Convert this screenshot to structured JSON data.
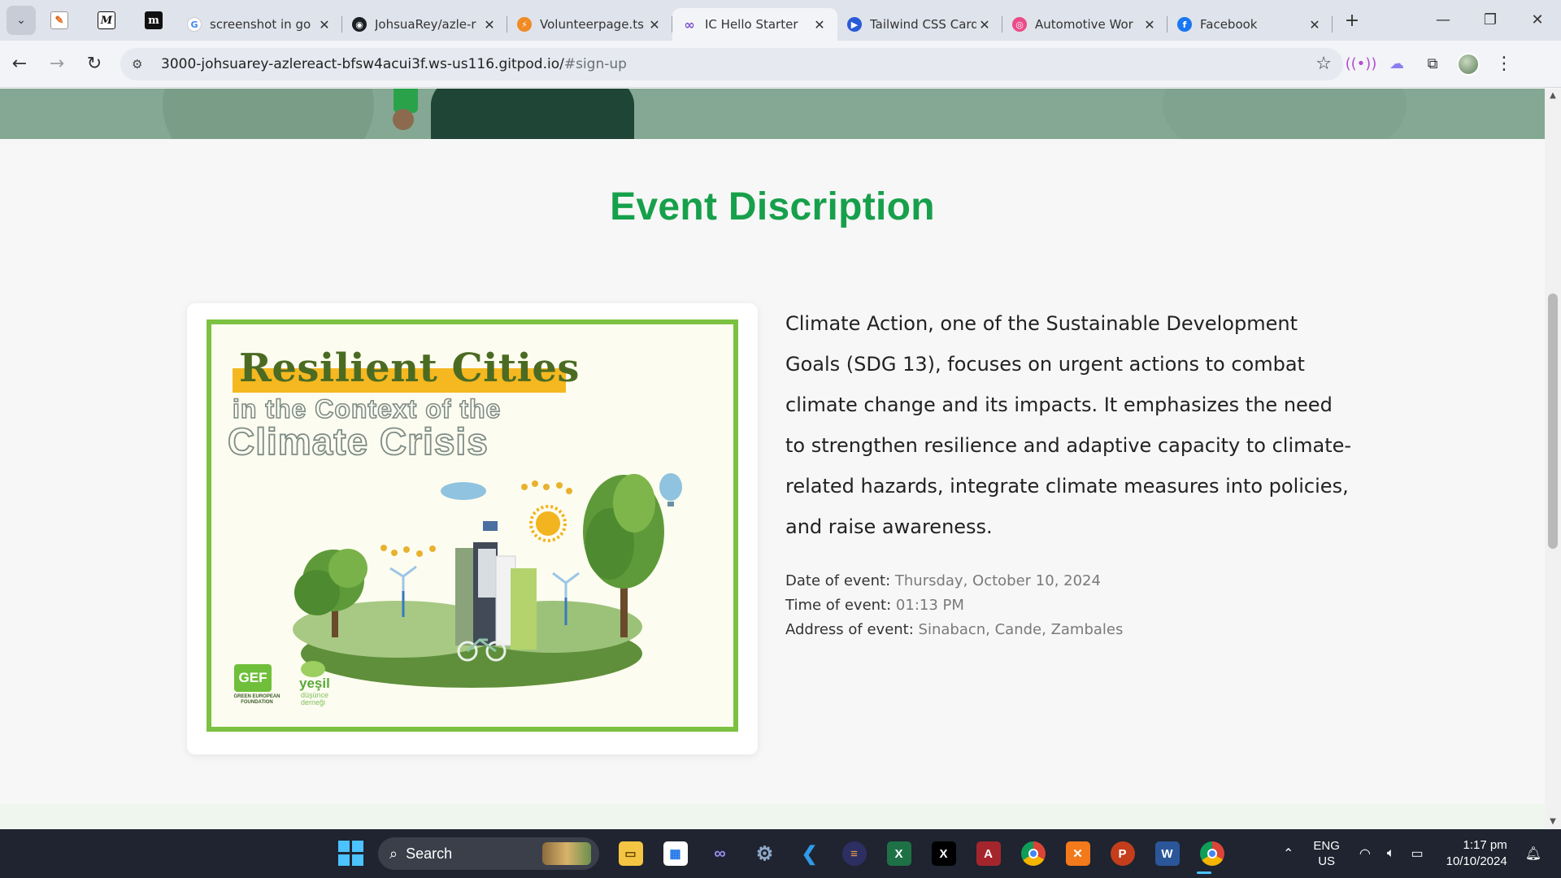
{
  "browser": {
    "tabs": [
      {
        "title": "screenshot in go",
        "favicon": "google-icon",
        "color": "#ffffff"
      },
      {
        "title": "JohsuaRey/azle-r",
        "favicon": "github-icon",
        "color": "#1b1f24"
      },
      {
        "title": "Volunteerpage.ts",
        "favicon": "stackblitz-icon",
        "color": "#f08a24"
      },
      {
        "title": "IC Hello Starter",
        "favicon": "infinity-icon",
        "color": "#ffffff"
      },
      {
        "title": "Tailwind CSS Card",
        "favicon": "play-icon",
        "color": "#2a5bd7"
      },
      {
        "title": "Automotive Wor",
        "favicon": "dribbble-icon",
        "color": "#ea4c89"
      },
      {
        "title": "Facebook",
        "favicon": "facebook-icon",
        "color": "#1877f2"
      }
    ],
    "active_tab_index": 3,
    "url_host": "3000-johsuarey-azlereact-bfsw4acui3f.ws-us116.gitpod.io/",
    "url_path": "#sign-up"
  },
  "section": {
    "title": "Event Discription"
  },
  "poster": {
    "title": "Resilient Cities",
    "subtitle_line1": "in the Context of the",
    "subtitle_line2": "Climate Crisis",
    "logo1": "GEF",
    "logo1_caption": "GREEN EUROPEAN FOUNDATION",
    "logo2": "yeşil",
    "logo2_caption_line1": "düşünce",
    "logo2_caption_line2": "derneği"
  },
  "event": {
    "description": "Climate Action, one of the Sustainable Development Goals (SDG 13), focuses on urgent actions to combat climate change and its impacts. It emphasizes the need to strengthen resilience and adaptive capacity to climate-related hazards, integrate climate measures into policies, and raise awareness.",
    "date_label": "Date of event:",
    "date_value": "Thursday, October 10, 2024",
    "time_label": "Time of event:",
    "time_value": "01:13 PM",
    "address_label": "Address of event:",
    "address_value": "Sinabacn, Cande, Zambales"
  },
  "taskbar": {
    "search_placeholder": "Search",
    "lang_line1": "ENG",
    "lang_line2": "US",
    "time": "1:17 pm",
    "date": "10/10/2024"
  },
  "colors": {
    "accent_green": "#17a04b",
    "poster_border": "#7cc142"
  }
}
